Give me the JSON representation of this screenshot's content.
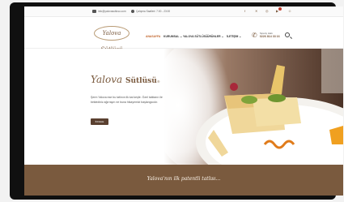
{
  "topbar": {
    "email": "info@yalovasutlusu.com",
    "hours": "Çalışma Saatleri: 7:00 - 23:00",
    "social_icons": [
      "facebook-icon",
      "twitter-icon",
      "instagram-icon",
      "youtube-icon"
    ]
  },
  "header": {
    "logo": "Yalova Sütlüsü",
    "nav": [
      {
        "label": "ANASAYFA",
        "active": true
      },
      {
        "label": "KURUMSAL ⌄",
        "active": false
      },
      {
        "label": "YALOVA SÜTLÜSÜ",
        "active": false
      },
      {
        "label": "ÜRÜNLER ⌄",
        "active": false
      },
      {
        "label": "İLETİŞİM ⌄",
        "active": false
      }
    ],
    "phone_label": "Sipariş Hattı",
    "phone_number": "0226 814 33 16"
  },
  "hero": {
    "brand_script": "Yalova",
    "brand_bold": "Sütlüsü",
    "brand_mark": "®",
    "description": "Şerm Yalova ese bu tatlının ilk kai keşfe. Özel tatlıların ile beklediniz ağırrayın ne buna hikayemizi başlangıcıdır.",
    "button": "İNCELE"
  },
  "band": {
    "tagline": "Yalova'nın ilk patentli tatlısı..."
  },
  "colors": {
    "brand_brown": "#7a5a3e",
    "active_nav": "#c0632a",
    "button_dark": "#5a4030"
  }
}
